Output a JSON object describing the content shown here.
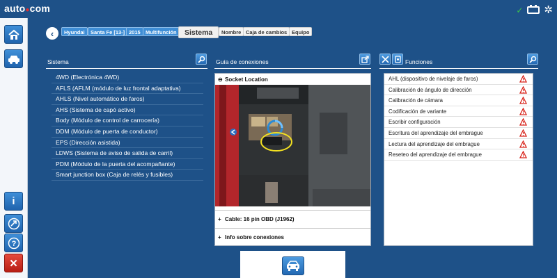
{
  "app": {
    "logo": "auto",
    "logo_suffix": "com"
  },
  "breadcrumb": {
    "items": [
      "Hyundai",
      "Santa Fe [13-]",
      "2015",
      "Multifunción"
    ],
    "active": "Sistema",
    "after": [
      "Nombre",
      "Caja de cambios",
      "Equipo"
    ]
  },
  "sistema": {
    "title": "Sistema",
    "items": [
      "4WD (Electrónica 4WD)",
      "AFLS (AFLM (módulo de luz frontal adaptativa)",
      "AHLS (Nivel automático de faros)",
      "AHS (Sistema de capó activo)",
      "Body (Módulo de control de carrocería)",
      "DDM (Módulo de puerta de conductor)",
      "EPS (Dirección asistida)",
      "LDWS (Sistema de aviso de salida de carril)",
      "PDM (Módulo de la puerta del acompañante)",
      "Smart junction box (Caja de relés y fusibles)"
    ]
  },
  "guia": {
    "title": "Guía de conexiones",
    "socket_label": "Socket Location",
    "cable_label": "Cable: 16 pin OBD (J1962)",
    "info_label": "Info sobre conexiones"
  },
  "funciones": {
    "title": "Funciones",
    "items": [
      "AHL (dispositivo de nivelaje de faros)",
      "Calibración de ángulo de dirección",
      "Calibración de cámara",
      "Codificación de variante",
      "Escribir configuración",
      "Escritura del aprendizaje del embrague",
      "Lectura del aprendizaje del embrague",
      "Reseteo del aprendizaje del embrague"
    ]
  },
  "icons": {
    "sidebar": [
      "home-icon",
      "car-connect-icon",
      "info-icon",
      "plane-icon",
      "help-icon",
      "close-icon"
    ],
    "warning_color": "#d8231a",
    "accent": "#1e5188"
  }
}
